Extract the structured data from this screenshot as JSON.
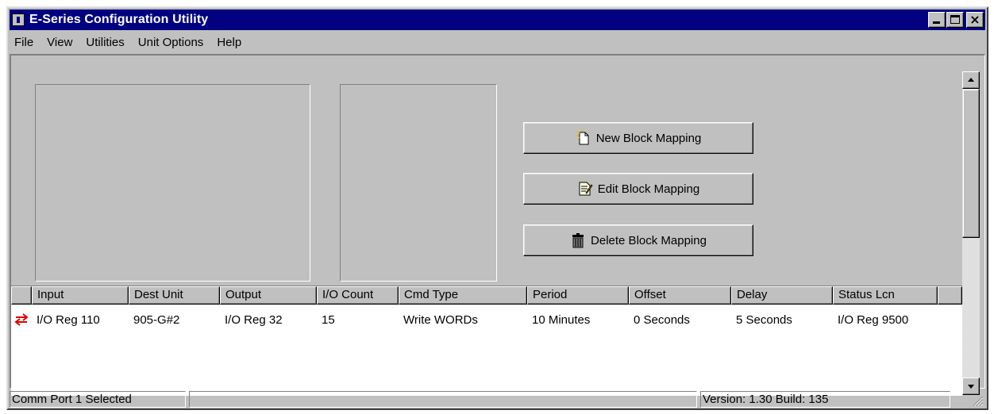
{
  "window": {
    "title": "E-Series Configuration Utility",
    "icon": "app-icon"
  },
  "titlebar_buttons": {
    "minimize": "minimize-icon",
    "maximize": "maximize-icon",
    "close": "×"
  },
  "menu": [
    "File",
    "View",
    "Utilities",
    "Unit Options",
    "Help"
  ],
  "buttons": {
    "new_block": "New Block Mapping",
    "edit_block": "Edit Block Mapping",
    "delete_block": "Delete Block Mapping"
  },
  "table": {
    "columns": [
      "Input",
      "Dest Unit",
      "Output",
      "I/O Count",
      "Cmd Type",
      "Period",
      "Offset",
      "Delay",
      "Status Lcn"
    ],
    "rows": [
      {
        "icon": "transfer-arrows-icon",
        "cells": [
          "I/O Reg 110",
          "905-G#2",
          "I/O Reg 32",
          "15",
          "Write WORDs",
          "10 Minutes",
          "0 Seconds",
          "5 Seconds",
          "I/O Reg 9500"
        ]
      }
    ]
  },
  "status": {
    "port": "Comm Port 1 Selected",
    "middle": "",
    "version": "Version: 1.30 Build: 135"
  },
  "colors": {
    "titlebar": "#000080",
    "face": "#c0c0c0",
    "row_icon": "#e00000"
  }
}
